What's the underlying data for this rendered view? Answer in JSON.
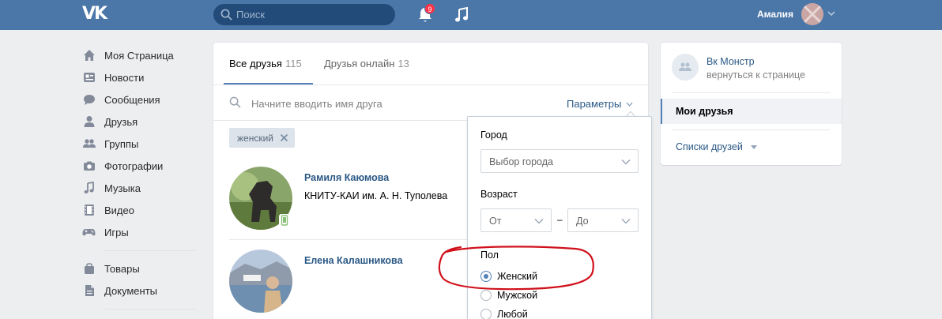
{
  "header": {
    "logo": "VK",
    "search_placeholder": "Поиск",
    "notifications_count": "9",
    "user_name": "Амалия"
  },
  "sidebar": {
    "items": [
      {
        "label": "Моя Страница",
        "icon": "home-icon"
      },
      {
        "label": "Новости",
        "icon": "news-icon"
      },
      {
        "label": "Сообщения",
        "icon": "messages-icon"
      },
      {
        "label": "Друзья",
        "icon": "person-icon"
      },
      {
        "label": "Группы",
        "icon": "groups-icon"
      },
      {
        "label": "Фотографии",
        "icon": "camera-icon"
      },
      {
        "label": "Музыка",
        "icon": "music-note-icon"
      },
      {
        "label": "Видео",
        "icon": "film-icon"
      },
      {
        "label": "Игры",
        "icon": "gamepad-icon"
      }
    ],
    "items2": [
      {
        "label": "Товары",
        "icon": "bag-icon"
      },
      {
        "label": "Документы",
        "icon": "document-icon"
      }
    ]
  },
  "main": {
    "tabs": [
      {
        "label": "Все друзья",
        "count": "115"
      },
      {
        "label": "Друзья онлайн",
        "count": "13"
      }
    ],
    "search_placeholder": "Начните вводить имя друга",
    "params_label": "Параметры",
    "chip_label": "женский",
    "friends": [
      {
        "name": "Рамиля Каюмова",
        "subtitle": "КНИТУ-КАИ им. А. Н. Туполева"
      },
      {
        "name": "Елена Калашникова",
        "subtitle": ""
      }
    ]
  },
  "dropdown": {
    "city_label": "Город",
    "city_value": "Выбор города",
    "age_label": "Возраст",
    "age_from": "От",
    "age_dash": "–",
    "age_to": "До",
    "gender_label": "Пол",
    "gender_options": [
      "Женский",
      "Мужской",
      "Любой"
    ],
    "gender_selected": "Женский"
  },
  "right_panel": {
    "group_name": "Вк Монстр",
    "group_back": "вернуться к странице",
    "active_item": "Мои друзья",
    "lists_label": "Списки друзей"
  },
  "colors": {
    "header": "#4a76a8",
    "link": "#2a5885",
    "accent": "#5181b8",
    "annotation_red": "#d0111b"
  }
}
